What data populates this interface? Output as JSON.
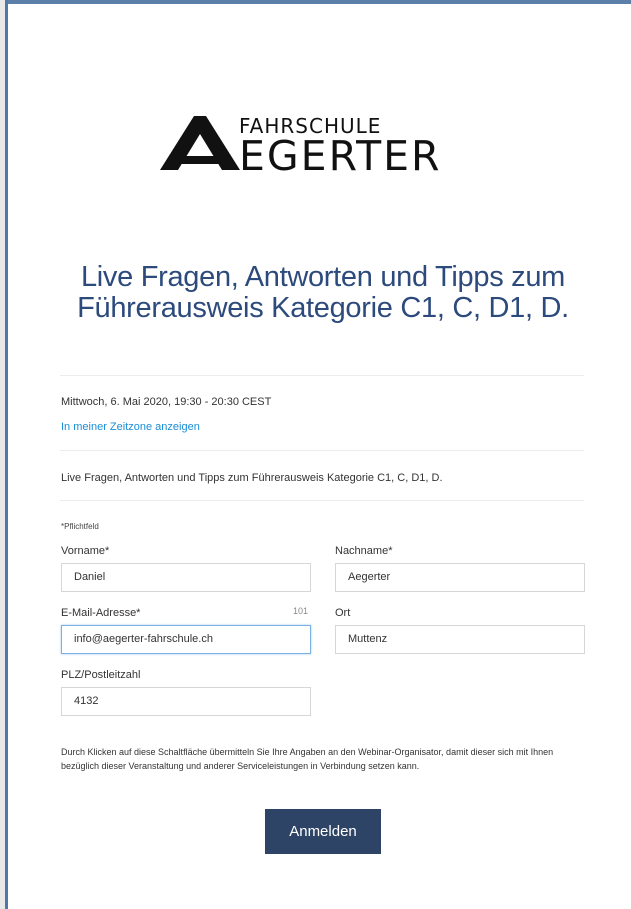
{
  "logo": {
    "line1": "FAHRSCHULE",
    "line2": "EGERTER",
    "mark": "A"
  },
  "event": {
    "title": "Live Fragen, Antworten und Tipps zum Führerausweis Kategorie C1, C, D1, D.",
    "datetime": "Mittwoch, 6. Mai 2020, 19:30 - 20:30 CEST",
    "timezone_link": "In meiner Zeitzone anzeigen",
    "description": "Live Fragen, Antworten und Tipps zum Führerausweis Kategorie C1, C, D1, D."
  },
  "form": {
    "required_note": "*Pflichtfeld",
    "firstname": {
      "label": "Vorname*",
      "value": "Daniel"
    },
    "lastname": {
      "label": "Nachname*",
      "value": "Aegerter"
    },
    "email": {
      "label": "E-Mail-Adresse*",
      "value": "info@aegerter-fahrschule.ch",
      "counter": "101"
    },
    "city": {
      "label": "Ort",
      "value": "Muttenz"
    },
    "zip": {
      "label": "PLZ/Postleitzahl",
      "value": "4132"
    },
    "legal": "Durch Klicken auf diese Schaltfläche übermitteln Sie Ihre Angaben an den Webinar-Organisator, damit dieser sich mit Ihnen bezüglich dieser Veranstaltung und anderer Serviceleistungen in Verbindung setzen kann.",
    "submit_label": "Anmelden"
  },
  "colors": {
    "accent": "#2e4466",
    "title": "#2d4a7c",
    "link": "#1a8fd6",
    "frame": "#4f78a8"
  }
}
